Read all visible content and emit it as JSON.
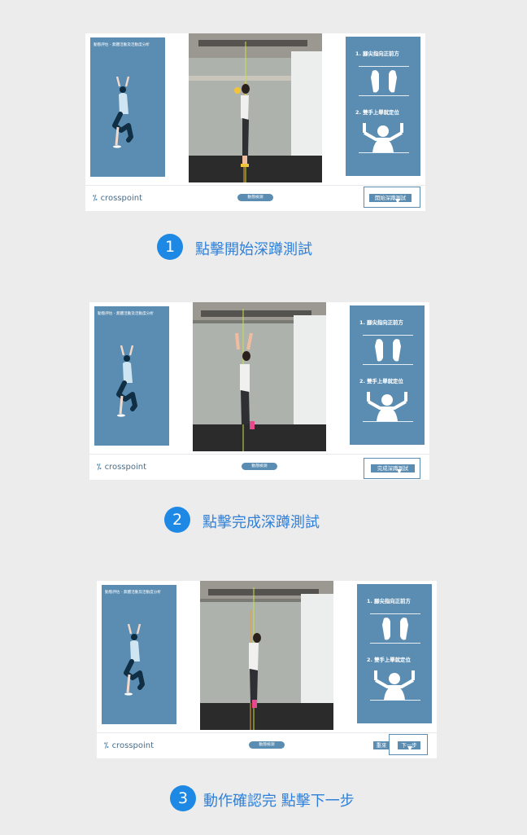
{
  "common": {
    "left_panel_title": "動態評估 - 無體活動及活動度分析",
    "instruction_1": "1. 腳尖指向正前方",
    "instruction_2": "2. 雙手上舉就定位",
    "brand": "crosspoint",
    "detect_pill": "動態檢測"
  },
  "steps": [
    {
      "number": "1",
      "caption": "點擊開始深蹲測試",
      "action_button": "開始深蹲測試"
    },
    {
      "number": "2",
      "caption": "點擊完成深蹲測試",
      "action_button": "完成深蹲測試"
    },
    {
      "number": "3",
      "caption": "動作確認完 點擊下一步",
      "action_button": "下一步",
      "reset_button": "重來"
    }
  ]
}
